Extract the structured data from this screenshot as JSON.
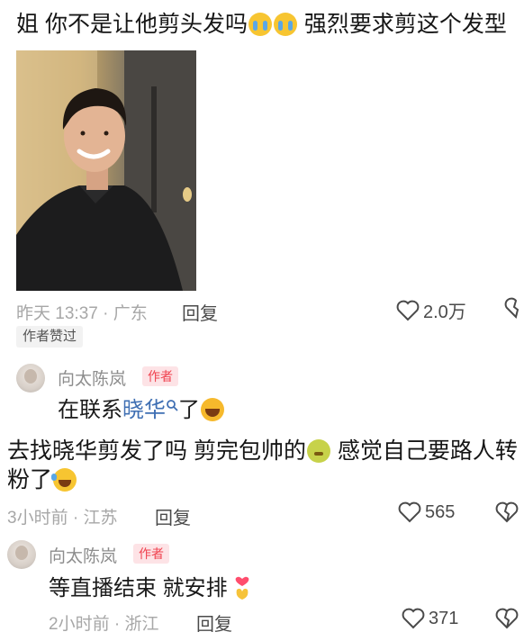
{
  "post": {
    "text": "姐 你不是让他剪头发吗",
    "text_after": "  强烈要求剪这个发型",
    "time_loc": "昨天 13:37 · 广东",
    "reply_label": "回复",
    "likes": "2.0万",
    "liked_by_author": "作者赞过",
    "emojis": [
      "cry-emoji",
      "cry-emoji"
    ]
  },
  "reply1": {
    "username": "向太陈岚",
    "badge": "作者",
    "text_before": "在联系",
    "link": "晓华",
    "text_after": "了"
  },
  "comment2": {
    "line1_a": "去找晓华剪发了吗  剪完包帅的",
    "line1_b": " 感觉自己要路人转",
    "line2": "粉了",
    "time_loc": "3小时前 · 江苏",
    "reply_label": "回复",
    "likes": "565"
  },
  "reply2": {
    "username": "向太陈岚",
    "badge": "作者",
    "text": "等直播结束 就安排",
    "time_loc": "2小时前 · 浙江",
    "reply_label": "回复",
    "likes": "371"
  },
  "colors": {
    "meta": "#a7a7a7",
    "author_badge_text": "#f0424f",
    "author_badge_bg": "#fde3e6",
    "link": "#3f6fb3"
  }
}
